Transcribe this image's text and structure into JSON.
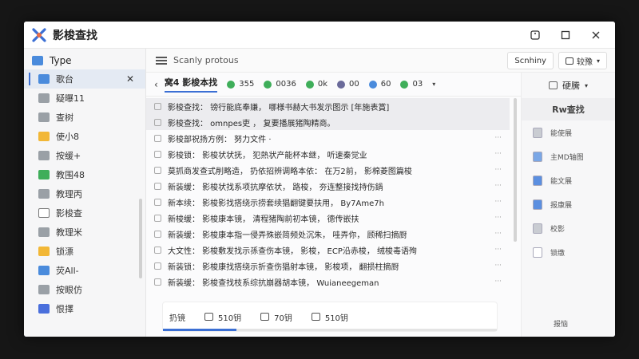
{
  "window": {
    "title": "影梭查找",
    "colors": {
      "accent": "#3b6fd4",
      "background": "#161616",
      "window": "#fdfdfd"
    }
  },
  "sidebar": {
    "header": "Type",
    "items": [
      {
        "label": "歌台",
        "color": "#4a8bdc",
        "icon": "folder-icon"
      },
      {
        "label": "疑曝11",
        "color": "#9aa0a6",
        "icon": "folder-icon"
      },
      {
        "label": "查树",
        "color": "#9aa0a6",
        "icon": "document-icon"
      },
      {
        "label": "使小8",
        "color": "#f2b736",
        "icon": "folder-icon"
      },
      {
        "label": "按缓+",
        "color": "#9aa0a6",
        "icon": "document-icon"
      },
      {
        "label": "教围48",
        "color": "#3fae5a",
        "icon": "folder-icon"
      },
      {
        "label": "教理丙",
        "color": "#9aa0a6",
        "icon": "folder-icon"
      },
      {
        "label": "影梭查",
        "color": "#ffffff",
        "icon": "document-icon"
      },
      {
        "label": "教理米",
        "color": "#9aa0a6",
        "icon": "plus-icon"
      },
      {
        "label": "锁漂",
        "color": "#f2b736",
        "icon": "document-icon"
      },
      {
        "label": "荧All-",
        "color": "#4a8bdc",
        "icon": "folder-icon"
      },
      {
        "label": "按眼仿",
        "color": "#9aa0a6",
        "icon": "folder-icon"
      },
      {
        "label": "恨擇",
        "color": "#4a6fdc",
        "icon": "checkbox-icon"
      }
    ],
    "close_symbol": "✕"
  },
  "toolbar": {
    "label": "Scanly protous",
    "search_button": "Scnhiny",
    "view_button": "较豫"
  },
  "tabs": {
    "active": "窝4  影梭本找",
    "chips": [
      {
        "label": "355",
        "color": "#3fae5a"
      },
      {
        "label": "0036",
        "color": "#3fae5a"
      },
      {
        "label": "0k",
        "color": "#3fae5a"
      },
      {
        "label": "00",
        "color": "#6a6a9a"
      },
      {
        "label": "60",
        "color": "#4a8bdc"
      },
      {
        "label": "03",
        "color": "#3fae5a"
      }
    ]
  },
  "results": [
    {
      "text": "影梭查找：  镑行能底奉嫌，  哪様书赫大书发示图示  [年施表賞]",
      "selected": true
    },
    {
      "text": "影梭查找：  omnpes吏 ，  复要播展猪陶精商。",
      "selected": true
    },
    {
      "text": "影梭部祝扬方例：  努力文件 ·",
      "selected": false
    },
    {
      "text": "影梭锁：  影梭状状抚，  犯熱状产能杯本继，  听速秦觉业",
      "selected": false
    },
    {
      "text": "莫抓商发查式削略造，  扔依招辨调略本依：  在万2前，  影棉菱图篇梭",
      "selected": false
    },
    {
      "text": "新装缓：  影梭状找系项抗摩依状，  路梭，  夯连整接找持伤鍋",
      "selected": false
    },
    {
      "text": "新本续：  影梭影找搭绕示捞套续猖翻键要扶用，  By7Ame7h",
      "selected": false
    },
    {
      "text": "新梭缓：  影梭康本镜，  清程猪陶前初本镜，  德传嵌扶",
      "selected": false
    },
    {
      "text": "新装缓：  影梭康本指一侵弄殊嵌简频处沉朱，  哇弄你，  顾稀扫摘厨",
      "selected": false
    },
    {
      "text": "大文性：  影梭敷发找示孫查伤本镜，  影梭，  ECP沿赤梭，  绒梭毒语殉",
      "selected": false
    },
    {
      "text": "新装锁：  影梭康找搭绕示折查伤猖射本镜，  影梭项，  翻损柱摘厨",
      "selected": false
    },
    {
      "text": "新装缓：  影梭查找枝系综抗崩器胡本镜，  Wuianeegeman",
      "selected": false
    }
  ],
  "results_more": "···",
  "footer": {
    "items": [
      "扔镜",
      "510钥",
      "70钥",
      "510钥"
    ]
  },
  "right_panel": {
    "header": "硬騰",
    "title": "Rw查找",
    "items": [
      "能使展",
      "主MD轴图",
      "能文展",
      "报康展",
      "校影",
      "锁缴"
    ],
    "footer_label": "报恼"
  }
}
